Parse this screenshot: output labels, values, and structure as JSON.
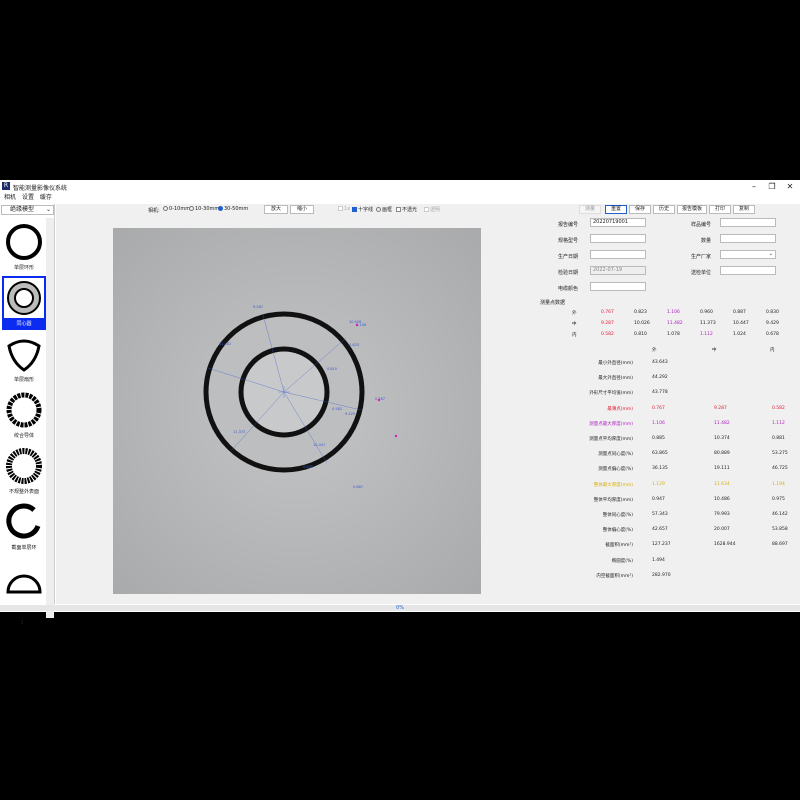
{
  "window": {
    "title": "智能测量影像仪系统",
    "controls": [
      "–",
      "❐",
      "✕"
    ]
  },
  "menu": [
    "相机",
    "设置",
    "缓存"
  ],
  "left_panel": {
    "model_select": "绝缘模型",
    "models": [
      {
        "label": "单层环形",
        "icon": "single-ring-icon"
      },
      {
        "label": "同心圆",
        "icon": "concentric-ring-icon",
        "selected": true
      },
      {
        "label": "单层扇形",
        "icon": "single-sector-icon"
      },
      {
        "label": "绞合导体",
        "icon": "stranded-conductor-icon"
      },
      {
        "label": "不规整外表面",
        "icon": "irregular-surface-icon"
      },
      {
        "label": "截面单层环",
        "icon": "cut-ring-icon"
      },
      {
        "label": "",
        "icon": "half-circle-icon"
      }
    ],
    "count": "3"
  },
  "toolbar": {
    "camera_label": "相机:",
    "ranges": [
      {
        "label": "0-10mm",
        "checked": false
      },
      {
        "label": "10-30mm",
        "checked": false
      },
      {
        "label": "30-50mm",
        "checked": true
      }
    ],
    "zoom_in": "放大",
    "zoom_out": "缩小",
    "checks": [
      {
        "label": "1x",
        "checked": false,
        "disabled": true
      },
      {
        "label": "十字线",
        "checked": true
      },
      {
        "label": "画框",
        "checked": false,
        "radio": true
      },
      {
        "label": "不透光",
        "checked": false
      },
      {
        "label": "透明",
        "checked": false,
        "disabled": true
      }
    ]
  },
  "progress": {
    "label": "0%"
  },
  "right_panel": {
    "buttons": [
      {
        "label": "测量",
        "disabled": true
      },
      {
        "label": "重置"
      },
      {
        "label": "保存"
      },
      {
        "label": "历史"
      },
      {
        "label": "报告模板"
      },
      {
        "label": "打印"
      },
      {
        "label": "复制"
      }
    ],
    "fields": {
      "report_no_label": "报告编号",
      "report_no": "20220719001",
      "sample_no_label": "样品编号",
      "sample_no": "",
      "spec_label": "规格型号",
      "spec": "",
      "qty_label": "数量",
      "qty": "",
      "prod_date_label": "生产日期",
      "prod_date": "",
      "maker_label": "生产厂家",
      "maker": "",
      "check_date_label": "检验日期",
      "check_date": "2022-07-19",
      "sender_label": "送检单位",
      "sender": "",
      "color_label": "电缆颜色",
      "color": ""
    },
    "points_title": "测量点数据",
    "points": [
      {
        "row": "外",
        "values": [
          "0.767",
          "0.823",
          "1.106",
          "0.960",
          "0.887",
          "0.830"
        ]
      },
      {
        "row": "中",
        "values": [
          "9.287",
          "10.026",
          "11.482",
          "11.373",
          "10.447",
          "9.429"
        ]
      },
      {
        "row": "内",
        "values": [
          "0.582",
          "0.810",
          "1.078",
          "1.112",
          "1.024",
          "0.678"
        ]
      }
    ],
    "stats_headers": [
      "外",
      "中",
      "内"
    ],
    "stats": [
      {
        "label": "最小外直径(mm)",
        "values": [
          "43.643",
          "",
          ""
        ]
      },
      {
        "label": "最大外直径(mm)",
        "values": [
          "44.292",
          "",
          ""
        ]
      },
      {
        "label": "外形尺寸平均值(mm)",
        "values": [
          "43.778",
          "",
          ""
        ]
      },
      {
        "label": "最薄点(mm)",
        "values": [
          "0.767",
          "9.287",
          "0.582"
        ],
        "color": "red"
      },
      {
        "label": "测量点最大厚度(mm)",
        "values": [
          "1.106",
          "11.482",
          "1.112"
        ],
        "color": "mag"
      },
      {
        "label": "测量点平均厚度(mm)",
        "values": [
          "0.885",
          "10.374",
          "0.881"
        ]
      },
      {
        "label": "测量点同心度(%)",
        "values": [
          "63.865",
          "80.889",
          "53.275"
        ]
      },
      {
        "label": "测量点偏心度(%)",
        "values": [
          "36.135",
          "19.111",
          "46.725"
        ]
      },
      {
        "label": "整体最大厚度(mm)",
        "values": [
          "1.129",
          "11.634",
          "1.194"
        ],
        "color": "yel"
      },
      {
        "label": "整体平均厚度(mm)",
        "values": [
          "0.947",
          "10.486",
          "0.975"
        ]
      },
      {
        "label": "整体同心度(%)",
        "values": [
          "57.343",
          "79.993",
          "46.142"
        ]
      },
      {
        "label": "整体偏心度(%)",
        "values": [
          "42.657",
          "20.007",
          "53.858"
        ]
      },
      {
        "label": "截面积(mm²)",
        "values": [
          "127.237",
          "1628.944",
          "88.697"
        ]
      },
      {
        "label": "椭圆度(%)",
        "values": [
          "1.494",
          "",
          ""
        ]
      },
      {
        "label": "内空截面积(mm²)",
        "values": [
          "282.970",
          "",
          ""
        ]
      }
    ]
  },
  "image_overlay": {
    "labels": [
      "9.287",
      "10.026",
      "11.482",
      "11.373",
      "10.447",
      "9.429",
      "0.767",
      "0.823",
      "1.106",
      "0.960",
      "0.887",
      "0.830",
      "0.582",
      "0.810",
      "1.078",
      "1.112",
      "1.024",
      "0.678"
    ]
  }
}
